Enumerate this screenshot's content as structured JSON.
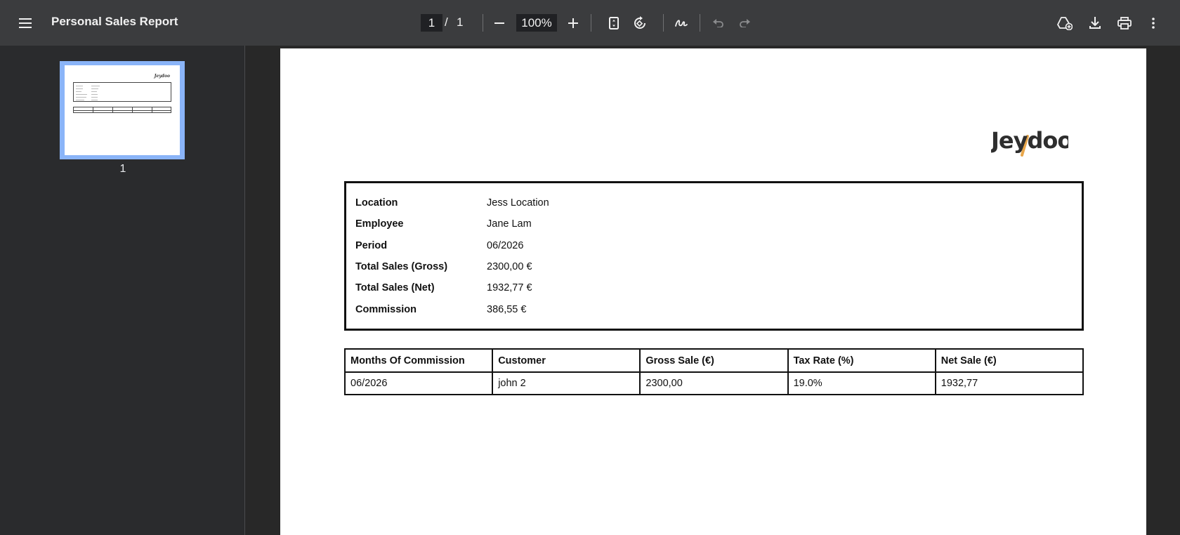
{
  "toolbar": {
    "title": "Personal Sales Report",
    "current_page": "1",
    "page_separator": "/",
    "total_pages": "1",
    "zoom": "100%",
    "icons": {
      "menu": "hamburger-menu-icon",
      "zoom_out": "minus-icon",
      "zoom_in": "plus-icon",
      "fit_page": "fit-page-icon",
      "rotate": "rotate-icon",
      "annotate": "signature-icon",
      "undo": "undo-icon",
      "redo": "redo-icon",
      "save_to_drive": "drive-add-icon",
      "download": "download-icon",
      "print": "print-icon",
      "more": "more-vertical-icon"
    }
  },
  "sidebar": {
    "thumbnails": [
      {
        "label": "1"
      }
    ]
  },
  "document": {
    "logo_text": "Jeydoo",
    "info": [
      {
        "label": "Location",
        "value": "Jess Location"
      },
      {
        "label": "Employee",
        "value": "Jane Lam"
      },
      {
        "label": "Period",
        "value": "06/2026"
      },
      {
        "label": "Total Sales (Gross)",
        "value": "2300,00 €"
      },
      {
        "label": "Total Sales (Net)",
        "value": "1932,77 €"
      },
      {
        "label": "Commission",
        "value": "386,55 €"
      }
    ],
    "table": {
      "headers": [
        "Months Of Commission",
        "Customer",
        "Gross Sale (€)",
        "Tax Rate (%)",
        "Net Sale (€)"
      ],
      "rows": [
        [
          "06/2026",
          "john 2",
          "2300,00",
          "19.0%",
          "1932,77"
        ]
      ]
    }
  },
  "colors": {
    "toolbar_bg": "#3b3c3e",
    "sidebar_bg": "#2a2b2d",
    "viewer_bg": "#282828",
    "thumbnail_selected": "#8ab4f8",
    "logo_accent": "#e8a64a"
  }
}
